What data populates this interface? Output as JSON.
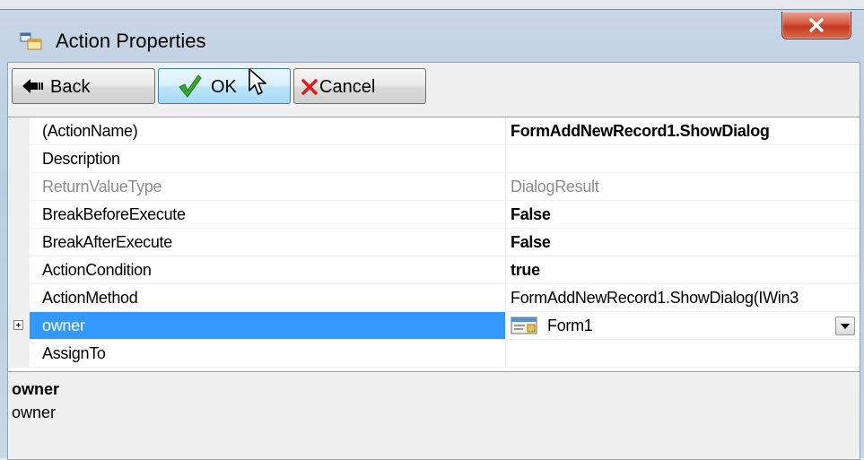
{
  "window": {
    "title": "Action Properties",
    "icon": "form-window-icon",
    "close_icon": "close-x-icon"
  },
  "toolbar": {
    "back_label": "Back",
    "ok_label": "OK",
    "cancel_label": "Cancel",
    "back_icon": "back-arrow-icon",
    "ok_icon": "green-check-icon",
    "cancel_icon": "red-x-icon"
  },
  "properties": [
    {
      "name": "(ActionName)",
      "value": "FormAddNewRecord1.ShowDialog",
      "value_style": "bold"
    },
    {
      "name": "Description",
      "value": ""
    },
    {
      "name": "ReturnValueType",
      "value": "DialogResult",
      "style": "readonly"
    },
    {
      "name": "BreakBeforeExecute",
      "value": "False",
      "value_style": "bold"
    },
    {
      "name": "BreakAfterExecute",
      "value": "False",
      "value_style": "bold"
    },
    {
      "name": "ActionCondition",
      "value": "true",
      "value_style": "bold"
    },
    {
      "name": "ActionMethod",
      "value": "FormAddNewRecord1.ShowDialog(IWin3"
    },
    {
      "name": "owner",
      "value": "Form1",
      "selected": true,
      "expandable": true,
      "has_dropdown": true
    },
    {
      "name": "AssignTo",
      "value": ""
    }
  ],
  "description": {
    "title": "owner",
    "text": "owner"
  },
  "colors": {
    "selection": "#3399ff",
    "close_button": "#c2381f",
    "readonly_text": "#8c8c8c"
  }
}
